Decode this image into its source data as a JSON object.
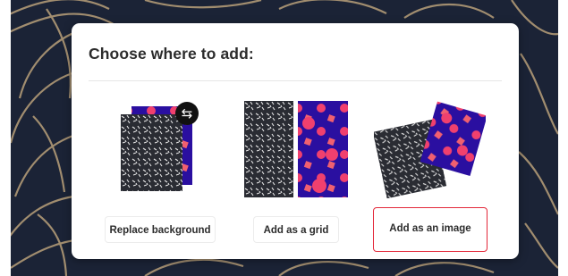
{
  "dialog": {
    "title": "Choose where to add:",
    "options": [
      {
        "label": "Replace background",
        "thumb_icon": "swap-icon",
        "selected": false
      },
      {
        "label": "Add as a grid",
        "selected": false
      },
      {
        "label": "Add as an image",
        "selected": true
      }
    ]
  },
  "colors": {
    "backdrop": "#1b2336",
    "gold_lines": "#b9a07a",
    "dialog_bg": "#ffffff",
    "pattern_dark": "#2a2c33",
    "pattern_blue": "#2a0fa0",
    "pattern_pink": "#f0406e",
    "selected_border": "#e3283a"
  }
}
